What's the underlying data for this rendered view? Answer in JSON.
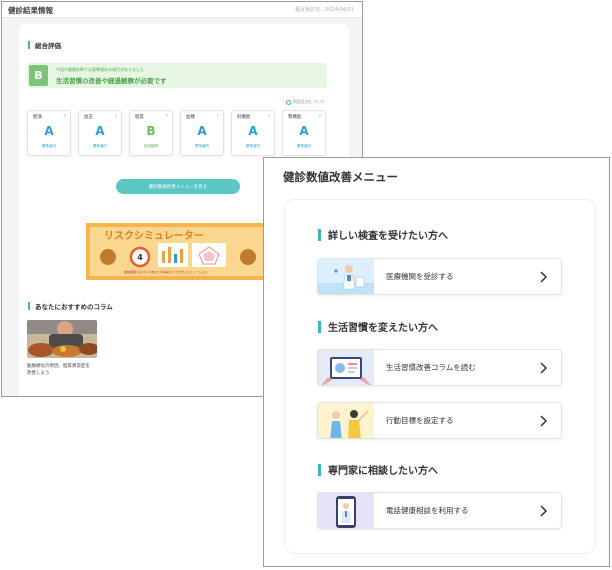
{
  "back": {
    "header_title": "健診結果情報",
    "header_date": "最近受診日：2024/04/01",
    "overall_heading": "総合評価",
    "grade": "B",
    "grade_note": "今回の健康診断では基準値外の項目がありました",
    "grade_message": "生活習慣の改善や経過観察が必要です",
    "judge_link": "判定区分について",
    "categories": [
      {
        "name": "肥満",
        "grade": "A",
        "status": "基準値内"
      },
      {
        "name": "血圧",
        "grade": "A",
        "status": "基準値内"
      },
      {
        "name": "脂質",
        "grade": "B",
        "status": "経過観察"
      },
      {
        "name": "血糖",
        "grade": "A",
        "status": "基準値内"
      },
      {
        "name": "肝機能",
        "grade": "A",
        "status": "基準値内"
      },
      {
        "name": "腎機能",
        "grade": "A",
        "status": "基準値内"
      }
    ],
    "menu_button": "健診数値改善メニューを見る",
    "risk_banner_title": "リスクシミュレーター",
    "risk_banner_note": "健診結果に基づいてあなたの将来のリスクをシミュレーション",
    "risk_gauge_value": "4",
    "column_heading": "あなたにおすすめのコラム",
    "column_caption_lines": [
      "動脈硬化の原因、脂質異常症を",
      "改善しよう"
    ]
  },
  "front": {
    "title": "健診数値改善メニュー",
    "sections": [
      {
        "heading": "詳しい検査を受けたい方へ"
      },
      {
        "heading": "生活習慣を変えたい方へ"
      },
      {
        "heading": "専門家に相談したい方へ"
      }
    ],
    "options": [
      {
        "label": "医療機関を受診する"
      },
      {
        "label": "生活習慣改善コラムを読む"
      },
      {
        "label": "行動目標を設定する"
      },
      {
        "label": "電話健康相談を利用する"
      }
    ]
  },
  "colors": {
    "accent": "#3fb8b0",
    "grade_a": "#2a9fd6",
    "grade_b": "#6cbf57",
    "button": "#5ac7c2"
  }
}
